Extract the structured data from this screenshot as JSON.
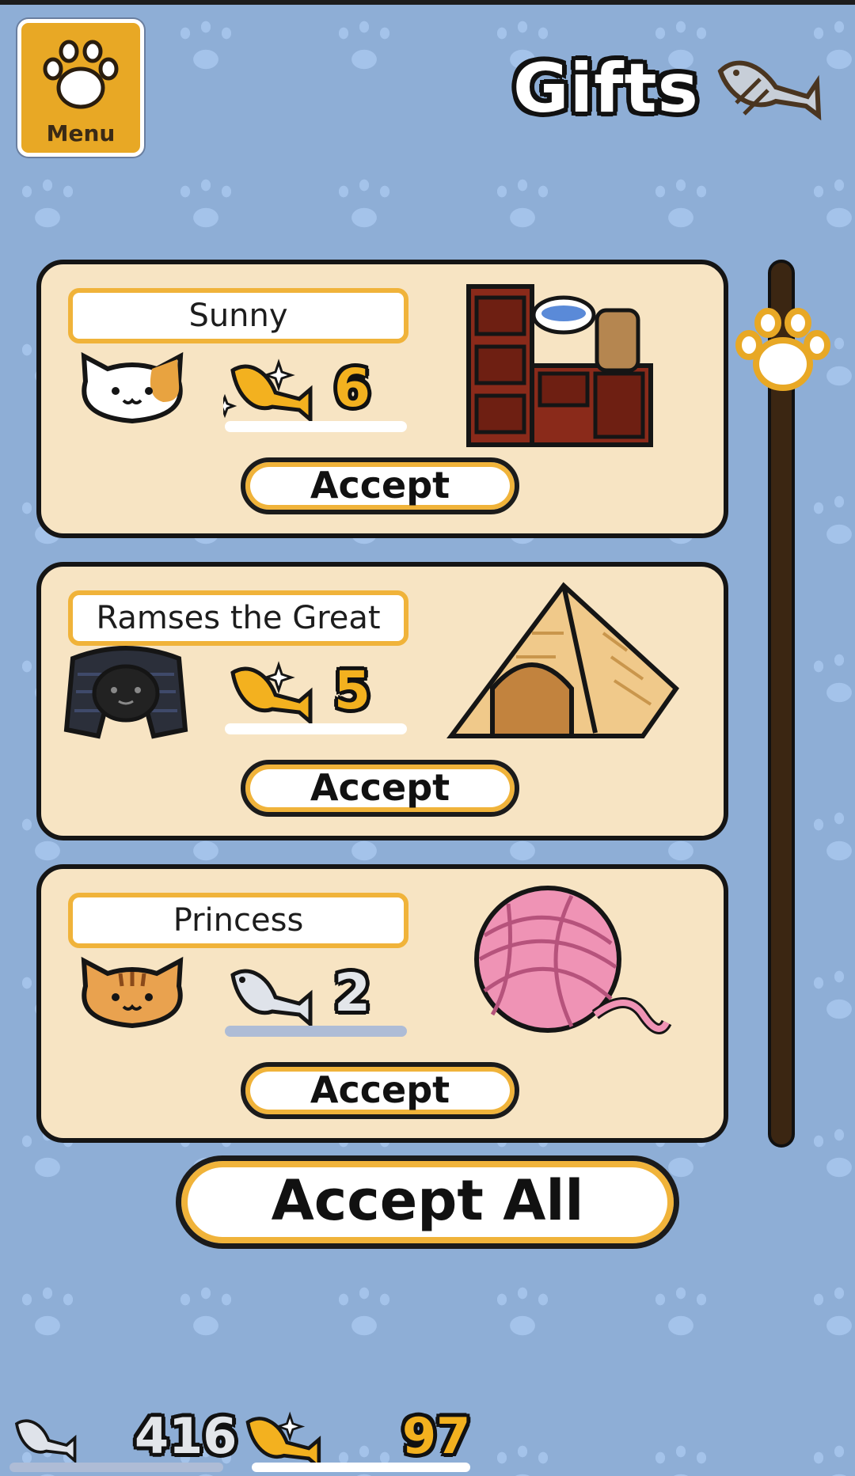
{
  "menu": {
    "label": "Menu",
    "icon": "paw-icon"
  },
  "header": {
    "title": "Gifts",
    "icon": "dried-fish-icon"
  },
  "gifts": [
    {
      "cat_name": "Sunny",
      "fish_type": "gold",
      "amount": "6",
      "gift_icon": "wooden-cabinet-icon",
      "accept_label": "Accept"
    },
    {
      "cat_name": "Ramses the Great",
      "fish_type": "gold",
      "amount": "5",
      "gift_icon": "pyramid-tent-icon",
      "accept_label": "Accept"
    },
    {
      "cat_name": "Princess",
      "fish_type": "silver",
      "amount": "2",
      "gift_icon": "yarn-ball-icon",
      "accept_label": "Accept"
    }
  ],
  "accept_all_label": "Accept All",
  "currency": {
    "silver_fish": "416",
    "gold_fish": "97"
  },
  "colors": {
    "background": "#8eaed6",
    "card": "#f7e4c3",
    "accent": "#f0b33a",
    "gold": "#f3b11f"
  }
}
